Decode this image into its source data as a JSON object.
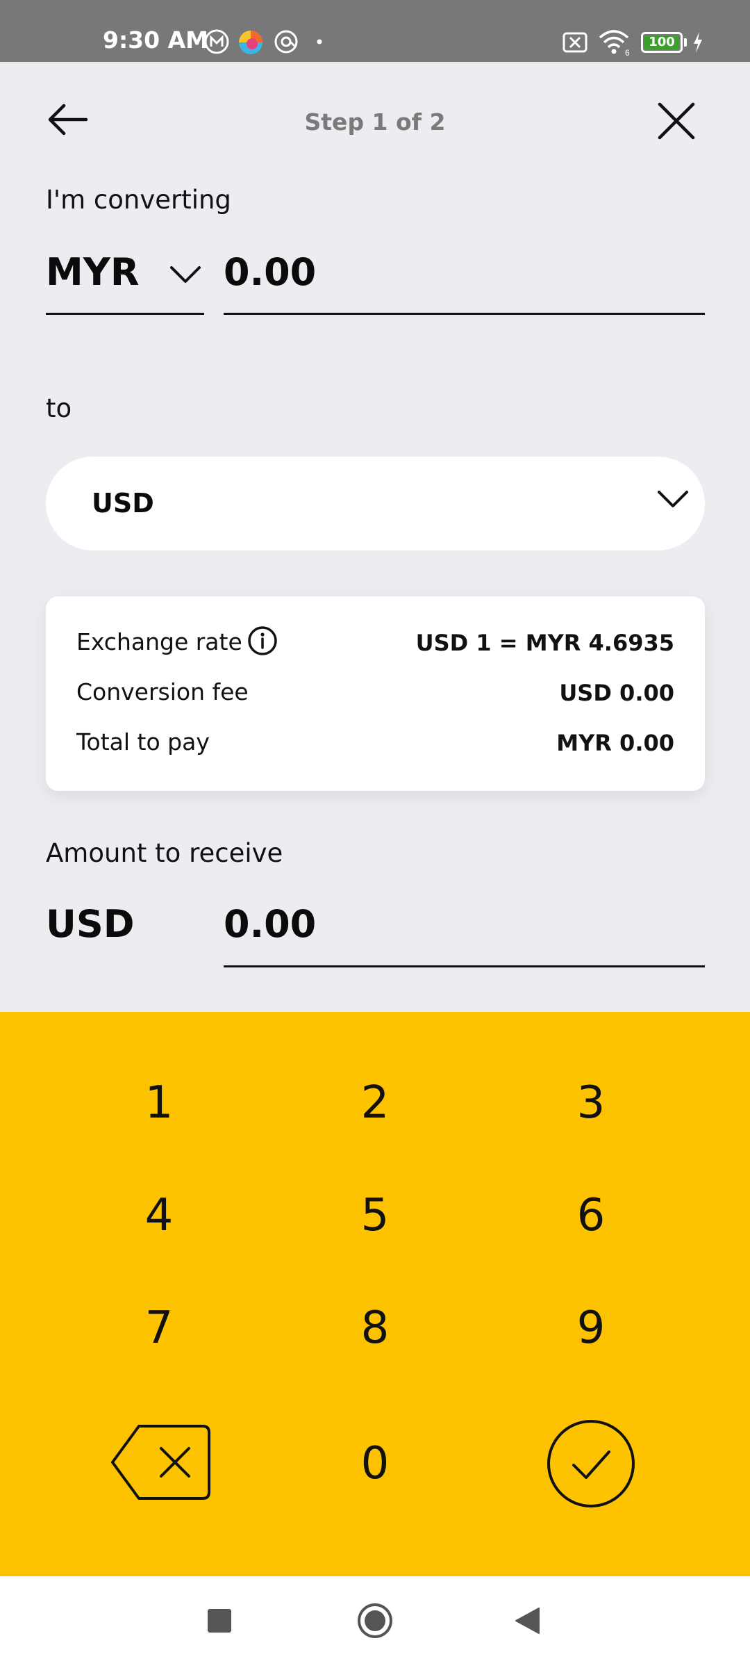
{
  "status_bar": {
    "time": "9:30 AM",
    "battery": "100",
    "icons": [
      "m-app-icon",
      "color-app-icon",
      "sync-icon",
      "dot-icon",
      "sim-off-icon",
      "wifi-icon",
      "battery-icon",
      "charging-icon"
    ]
  },
  "header": {
    "step": "Step 1 of 2",
    "back_icon": "arrow-left-icon",
    "close_icon": "close-icon"
  },
  "converting": {
    "label": "I'm converting",
    "currency": "MYR",
    "amount": "0.00"
  },
  "to": {
    "label": "to",
    "currency": "USD"
  },
  "summary": {
    "exchange_rate_label": "Exchange rate",
    "exchange_rate_value": "USD 1 = MYR 4.6935",
    "fee_label": "Conversion fee",
    "fee_value": "USD 0.00",
    "total_label": "Total to pay",
    "total_value": "MYR 0.00"
  },
  "receive": {
    "label": "Amount to receive",
    "currency": "USD",
    "amount": "0.00"
  },
  "keypad": {
    "keys": [
      "1",
      "2",
      "3",
      "4",
      "5",
      "6",
      "7",
      "8",
      "9",
      "0"
    ],
    "backspace_icon": "backspace-icon",
    "confirm_icon": "check-circle-icon",
    "color": "#fdc300"
  },
  "nav_bar": {
    "icons": [
      "recents-square-icon",
      "home-circle-icon",
      "back-triangle-icon"
    ]
  }
}
